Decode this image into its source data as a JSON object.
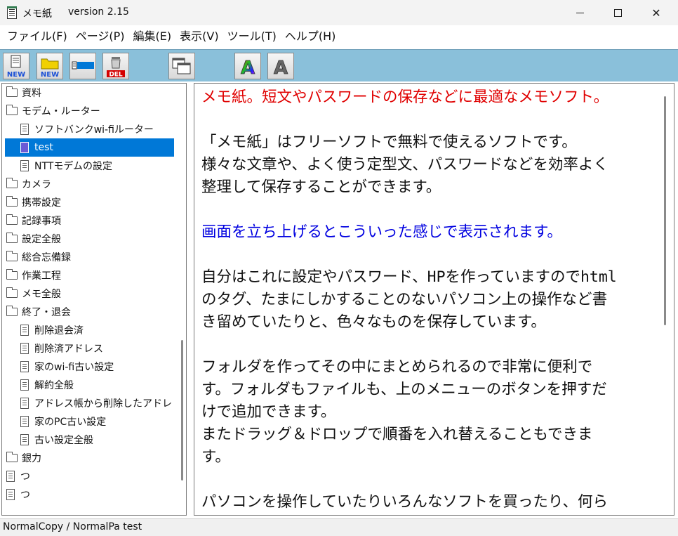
{
  "window": {
    "title": "メモ紙",
    "version": "version 2.15"
  },
  "menu": [
    {
      "label": "ファイル(F)"
    },
    {
      "label": "ページ(P)"
    },
    {
      "label": "編集(E)"
    },
    {
      "label": "表示(V)"
    },
    {
      "label": "ツール(T)"
    },
    {
      "label": "ヘルプ(H)"
    }
  ],
  "toolbar": {
    "new_file_label": "NEW",
    "new_folder_label": "NEW",
    "delete_label": "DEL",
    "font_color_letter": "A",
    "font_letter": "A",
    "colors": {
      "accent_blue": "#0078d7",
      "toolbar_bg": "#8ac0da"
    }
  },
  "tree": {
    "items": [
      {
        "label": "資料",
        "type": "folder",
        "indent": 0
      },
      {
        "label": "モデム・ルーター",
        "type": "folder",
        "indent": 0
      },
      {
        "label": "ソフトバンクwi-fiルーター",
        "type": "file",
        "indent": 1
      },
      {
        "label": "test",
        "type": "file",
        "indent": 1,
        "selected": true
      },
      {
        "label": "NTTモデムの設定",
        "type": "file",
        "indent": 1
      },
      {
        "label": "カメラ",
        "type": "folder",
        "indent": 0
      },
      {
        "label": "携帯設定",
        "type": "folder",
        "indent": 0
      },
      {
        "label": "記録事項",
        "type": "folder",
        "indent": 0
      },
      {
        "label": "設定全般",
        "type": "folder",
        "indent": 0
      },
      {
        "label": "総合忘備録",
        "type": "folder",
        "indent": 0
      },
      {
        "label": "作業工程",
        "type": "folder",
        "indent": 0
      },
      {
        "label": "メモ全般",
        "type": "folder",
        "indent": 0
      },
      {
        "label": "終了・退会",
        "type": "folder",
        "indent": 0
      },
      {
        "label": "削除退会済",
        "type": "file",
        "indent": 1
      },
      {
        "label": "削除済アドレス",
        "type": "file",
        "indent": 1
      },
      {
        "label": "家のwi-fi古い設定",
        "type": "file",
        "indent": 1
      },
      {
        "label": "解約全般",
        "type": "file",
        "indent": 1
      },
      {
        "label": "アドレス帳から削除したアドレ",
        "type": "file",
        "indent": 1
      },
      {
        "label": "家のPC古い設定",
        "type": "file",
        "indent": 1
      },
      {
        "label": "古い設定全般",
        "type": "file",
        "indent": 1
      },
      {
        "label": "銀力",
        "type": "folder",
        "indent": 0
      },
      {
        "label": "つ",
        "type": "file",
        "indent": 0
      },
      {
        "label": "つ",
        "type": "file",
        "indent": 0
      }
    ]
  },
  "editor": {
    "lines": [
      {
        "text": "メモ紙。短文やパスワードの保存などに最適なメモソフト。",
        "color": "red"
      },
      {
        "text": "",
        "color": "black"
      },
      {
        "text": "「メモ紙」はフリーソフトで無料で使えるソフトです。",
        "color": "black"
      },
      {
        "text": "様々な文章や、よく使う定型文、パスワードなどを効率よく",
        "color": "black"
      },
      {
        "text": "整理して保存することができます。",
        "color": "black"
      },
      {
        "text": "",
        "color": "black"
      },
      {
        "text": "画面を立ち上げるとこういった感じで表示されます。",
        "color": "blue"
      },
      {
        "text": "",
        "color": "black"
      },
      {
        "text": "自分はこれに設定やパスワード、HPを作っていますのでhtml",
        "color": "black"
      },
      {
        "text": "のタグ、たまにしかすることのないパソコン上の操作など書",
        "color": "black"
      },
      {
        "text": "き留めていたりと、色々なものを保存しています。",
        "color": "black"
      },
      {
        "text": "",
        "color": "black"
      },
      {
        "text": "フォルダを作ってその中にまとめられるので非常に便利で",
        "color": "black"
      },
      {
        "text": "す。フォルダもファイルも、上のメニューのボタンを押すだ",
        "color": "black"
      },
      {
        "text": "けで追加できます。",
        "color": "black"
      },
      {
        "text": "またドラッグ＆ドロップで順番を入れ替えることもできま",
        "color": "black"
      },
      {
        "text": "す。",
        "color": "black"
      },
      {
        "text": "",
        "color": "black"
      },
      {
        "text": "パソコンを操作していたりいろんなソフトを買ったり、何ら",
        "color": "black"
      }
    ]
  },
  "status": {
    "text": "NormalCopy / NormalPa test"
  }
}
